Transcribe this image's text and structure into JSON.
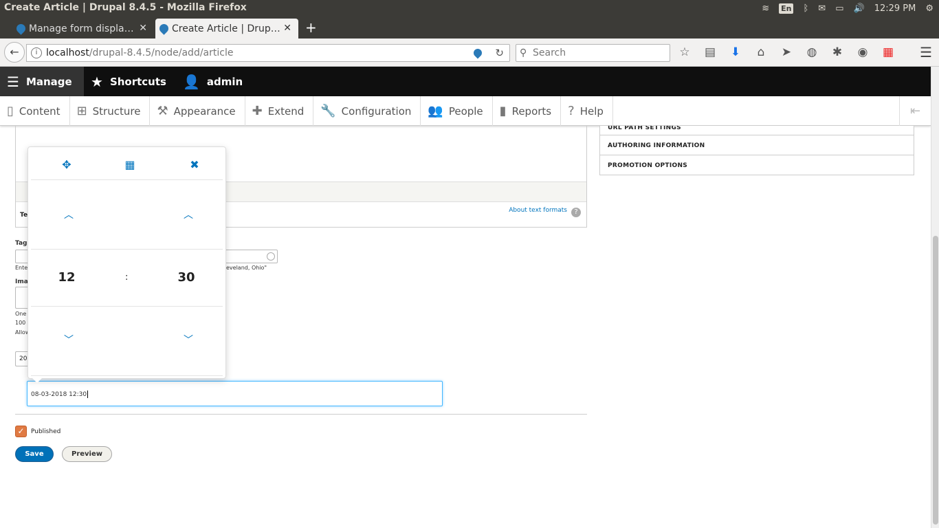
{
  "window": {
    "title": "Create Article | Drupal 8.4.5 - Mozilla Firefox",
    "lang": "En",
    "time": "12:29 PM"
  },
  "tabs": [
    {
      "label": "Manage form displa…"
    },
    {
      "label": "Create Article | Drup…"
    }
  ],
  "nav": {
    "url_host": "localhost",
    "url_path": "/drupal-8.4.5/node/add/article",
    "search_placeholder": "Search"
  },
  "toolbar": {
    "manage": "Manage",
    "shortcuts": "Shortcuts",
    "user": "admin",
    "menu": [
      {
        "label": "Content"
      },
      {
        "label": "Structure"
      },
      {
        "label": "Appearance"
      },
      {
        "label": "Extend"
      },
      {
        "label": "Configuration"
      },
      {
        "label": "People"
      },
      {
        "label": "Reports"
      },
      {
        "label": "Help"
      }
    ]
  },
  "form": {
    "about_text_formats": "About text formats",
    "frag_te": "Te",
    "frag_tag": "Tag",
    "frag_ente": "Ente",
    "frag_cleveland": "eveland, Ohio\"",
    "frag_ima": "Ima",
    "frag_one": "One",
    "frag_100": "100",
    "frag_allow": "Allow",
    "frag_20": "20",
    "date_value": "08-03-2018 12:30",
    "published_label": "Published",
    "save_label": "Save",
    "preview_label": "Preview"
  },
  "sidebar": {
    "items": [
      {
        "label": "URL PATH SETTINGS"
      },
      {
        "label": "AUTHORING INFORMATION"
      },
      {
        "label": "PROMOTION OPTIONS"
      }
    ]
  },
  "timepicker": {
    "hour": "12",
    "separator": ":",
    "minute": "30"
  }
}
